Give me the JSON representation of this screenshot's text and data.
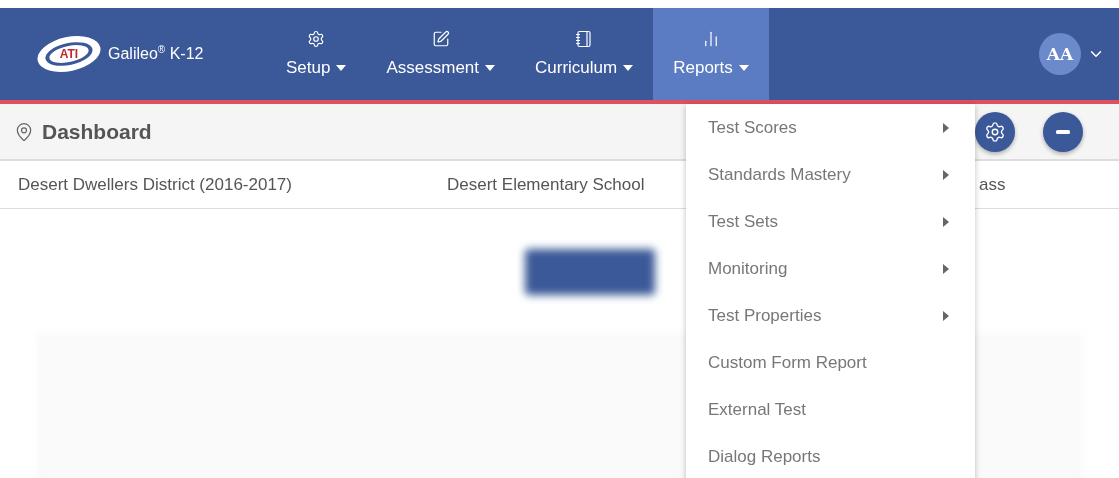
{
  "brand": {
    "mark": "ATI",
    "name": "Galileo$^{®}$ K-12"
  },
  "nav": [
    {
      "kind": "gear",
      "label": "Setup",
      "selected": false
    },
    {
      "kind": "pencil",
      "label": "Assessment",
      "selected": false
    },
    {
      "kind": "notebook",
      "label": "Curriculum",
      "selected": false
    },
    {
      "kind": "bars",
      "label": "Reports",
      "selected": true
    }
  ],
  "user": {
    "initials": "AA"
  },
  "page": {
    "title": "Dashboard"
  },
  "breadcrumbs": [
    "Desert Dwellers District (2016-2017)",
    "Desert Elementary School",
    "ass"
  ],
  "menu": [
    {
      "label": "Test Scores",
      "submenu": true
    },
    {
      "label": "Standards Mastery",
      "submenu": true
    },
    {
      "label": "Test Sets",
      "submenu": true
    },
    {
      "label": "Monitoring",
      "submenu": true
    },
    {
      "label": "Test Properties",
      "submenu": true
    },
    {
      "label": "Custom Form Report",
      "submenu": false
    },
    {
      "label": "External Test",
      "submenu": false
    },
    {
      "label": "Dialog Reports",
      "submenu": false
    }
  ]
}
